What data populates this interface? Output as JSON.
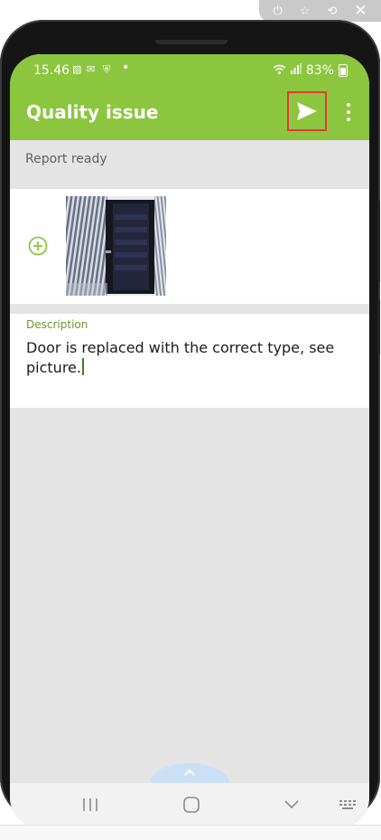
{
  "emulator": {
    "controls": [
      "power-icon",
      "pin-icon",
      "rotate-icon",
      "close-icon"
    ]
  },
  "status_bar": {
    "time": "15.46",
    "battery": "83%"
  },
  "app_bar": {
    "title": "Quality issue",
    "send_icon": "send-icon",
    "more_icon": "more-vert-icon"
  },
  "report": {
    "status": "Report ready"
  },
  "photos": {
    "add_icon": "add-circle-icon"
  },
  "description": {
    "label": "Description",
    "text": "Door is replaced with the correct type, see picture."
  },
  "nav_bar": {
    "items": [
      "recents-icon",
      "home-icon",
      "back-icon",
      "keyboard-icon"
    ]
  },
  "colors": {
    "primary": "#8cc63f",
    "accent_label": "#6a9a2c",
    "highlight": "#e53935",
    "background": "#e4e4e4"
  }
}
